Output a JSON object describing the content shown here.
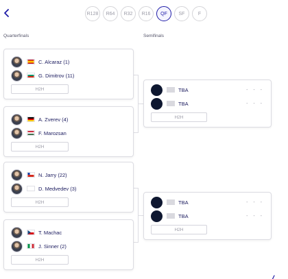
{
  "nav": {
    "back_icon": "chevron-left-icon"
  },
  "rounds": [
    {
      "label": "R128",
      "active": false
    },
    {
      "label": "R64",
      "active": false
    },
    {
      "label": "R32",
      "active": false
    },
    {
      "label": "R16",
      "active": false
    },
    {
      "label": "QF",
      "active": true
    },
    {
      "label": "SF",
      "active": false
    },
    {
      "label": "F",
      "active": false
    }
  ],
  "columns": {
    "left": "Quarterfinals",
    "right": "Semifinals"
  },
  "h2h_label": "H2H",
  "quarterfinals": [
    {
      "p1": {
        "name": "C. Alcaraz (1)",
        "flag": "spain"
      },
      "p2": {
        "name": "G. Dimitrov (11)",
        "flag": "bulgaria"
      }
    },
    {
      "p1": {
        "name": "A. Zverev (4)",
        "flag": "germany"
      },
      "p2": {
        "name": "F. Marozsan",
        "flag": "hungary"
      }
    },
    {
      "p1": {
        "name": "N. Jarry (22)",
        "flag": "chile"
      },
      "p2": {
        "name": "D. Medvedev (3)",
        "flag": "none"
      }
    },
    {
      "p1": {
        "name": "T. Machac",
        "flag": "czech"
      },
      "p2": {
        "name": "J. Sinner (2)",
        "flag": "italy"
      }
    }
  ],
  "semifinals": [
    {
      "p1": {
        "name": "TBA",
        "score": "- - -"
      },
      "p2": {
        "name": "TBA",
        "score": "- - -"
      }
    },
    {
      "p1": {
        "name": "TBA",
        "score": "- - -"
      },
      "p2": {
        "name": "TBA",
        "score": "- - -"
      }
    }
  ],
  "colors": {
    "accent": "#1d1aa6",
    "text": "#1a1a5e",
    "border": "#dcdce2",
    "tba_avatar": "#0e1730"
  }
}
